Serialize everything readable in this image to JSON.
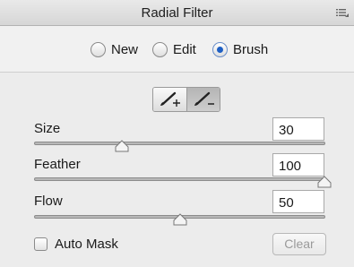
{
  "panel": {
    "title": "Radial Filter",
    "menu_icon": "panel-menu-icon"
  },
  "modes": [
    {
      "label": "New",
      "selected": false
    },
    {
      "label": "Edit",
      "selected": false
    },
    {
      "label": "Brush",
      "selected": true
    }
  ],
  "brush_tools": [
    {
      "icon": "brush-add-icon",
      "active": false
    },
    {
      "icon": "brush-erase-icon",
      "active": true
    }
  ],
  "sliders": [
    {
      "label": "Size",
      "value": "30",
      "fraction": 0.3
    },
    {
      "label": "Feather",
      "value": "100",
      "fraction": 1.0
    },
    {
      "label": "Flow",
      "value": "50",
      "fraction": 0.5
    }
  ],
  "auto_mask": {
    "label": "Auto Mask",
    "checked": false
  },
  "clear_button": {
    "label": "Clear",
    "enabled": false
  }
}
